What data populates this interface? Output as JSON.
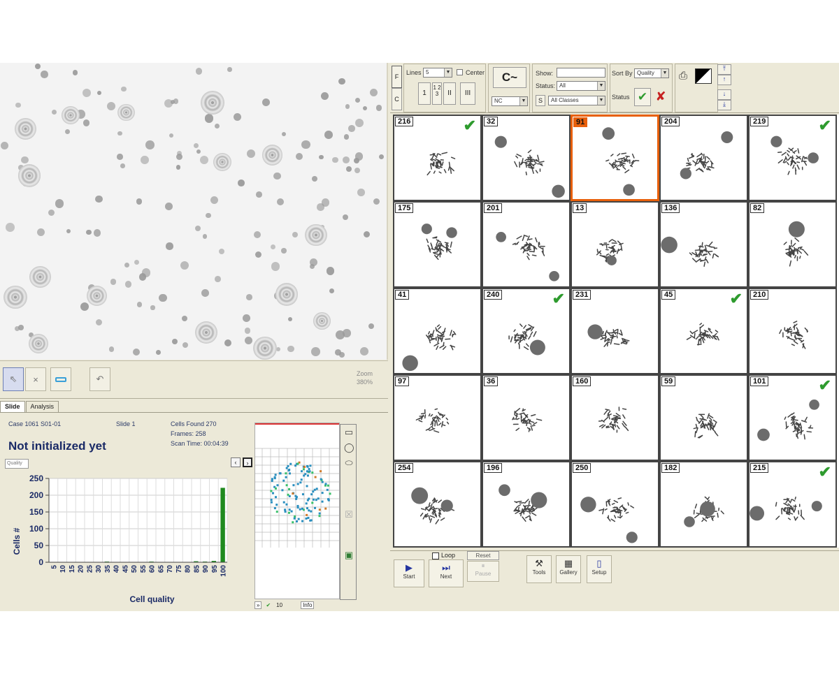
{
  "zoom": {
    "label": "Zoom",
    "value": "380%"
  },
  "tabs": [
    "Slide",
    "Analysis"
  ],
  "slide_info": {
    "case_label": "Case",
    "case_value": "1061 S01-01",
    "slide_label": "Slide",
    "slide_value": "1",
    "cells_label": "Cells Found",
    "cells_value": "270",
    "frames_label": "Frames:",
    "frames_value": "258",
    "scan_label": "Scan Time:",
    "scan_value": "00:04:39",
    "status": "Not initialized yet",
    "quality_box": "Quality"
  },
  "map_footer": {
    "arrows": "»",
    "count": "10",
    "info": "Info"
  },
  "chart_data": {
    "type": "bar",
    "categories": [
      "5",
      "10",
      "15",
      "20",
      "25",
      "30",
      "35",
      "40",
      "45",
      "50",
      "55",
      "60",
      "65",
      "70",
      "75",
      "80",
      "85",
      "90",
      "95",
      "100"
    ],
    "values": [
      1,
      1,
      1,
      1,
      1,
      1,
      2,
      1,
      1,
      1,
      1,
      2,
      1,
      1,
      1,
      1,
      3,
      2,
      4,
      222
    ],
    "xlabel": "Cell quality",
    "ylabel": "Cells #",
    "ylim": [
      0,
      250
    ],
    "yticks": [
      0,
      50,
      100,
      150,
      200,
      250
    ],
    "color": "#1f8a1f",
    "grid": true
  },
  "toolbar": {
    "f_label": "F",
    "c_label": "C",
    "lines_label": "Lines",
    "lines_value": "5",
    "center_label": "Center",
    "grid_buttons": [
      "1",
      "1 2 3",
      "II",
      "III"
    ],
    "refresh_icon": "C~",
    "class_value": "NC",
    "show_label": "Show:",
    "show_value": "",
    "status_label": "Status:",
    "status_value": "All",
    "s_label": "S",
    "classes_value": "All Classes",
    "sort_label": "Sort By",
    "sort_value": "Quality",
    "status2_label": "Status",
    "accept_icon": "✔",
    "reject_icon": "✘"
  },
  "gallery": [
    {
      "id": "216",
      "checked": true
    },
    {
      "id": "32",
      "checked": false
    },
    {
      "id": "91",
      "checked": false,
      "selected": true
    },
    {
      "id": "204",
      "checked": false
    },
    {
      "id": "219",
      "checked": true
    },
    {
      "id": "175",
      "checked": false
    },
    {
      "id": "201",
      "checked": false
    },
    {
      "id": "13",
      "checked": false
    },
    {
      "id": "136",
      "checked": false
    },
    {
      "id": "82",
      "checked": false
    },
    {
      "id": "41",
      "checked": false
    },
    {
      "id": "240",
      "checked": true
    },
    {
      "id": "231",
      "checked": false
    },
    {
      "id": "45",
      "checked": true
    },
    {
      "id": "210",
      "checked": false
    },
    {
      "id": "97",
      "checked": false
    },
    {
      "id": "36",
      "checked": false
    },
    {
      "id": "160",
      "checked": false
    },
    {
      "id": "59",
      "checked": false
    },
    {
      "id": "101",
      "checked": true
    },
    {
      "id": "254",
      "checked": false
    },
    {
      "id": "196",
      "checked": false
    },
    {
      "id": "250",
      "checked": false
    },
    {
      "id": "182",
      "checked": false
    },
    {
      "id": "215",
      "checked": true
    }
  ],
  "controls": {
    "start": "Start",
    "next": "Next",
    "pause": "Pause",
    "loop": "Loop",
    "reset": "Reset",
    "tools": "Tools",
    "gallery": "Gallery",
    "setup": "Setup"
  }
}
